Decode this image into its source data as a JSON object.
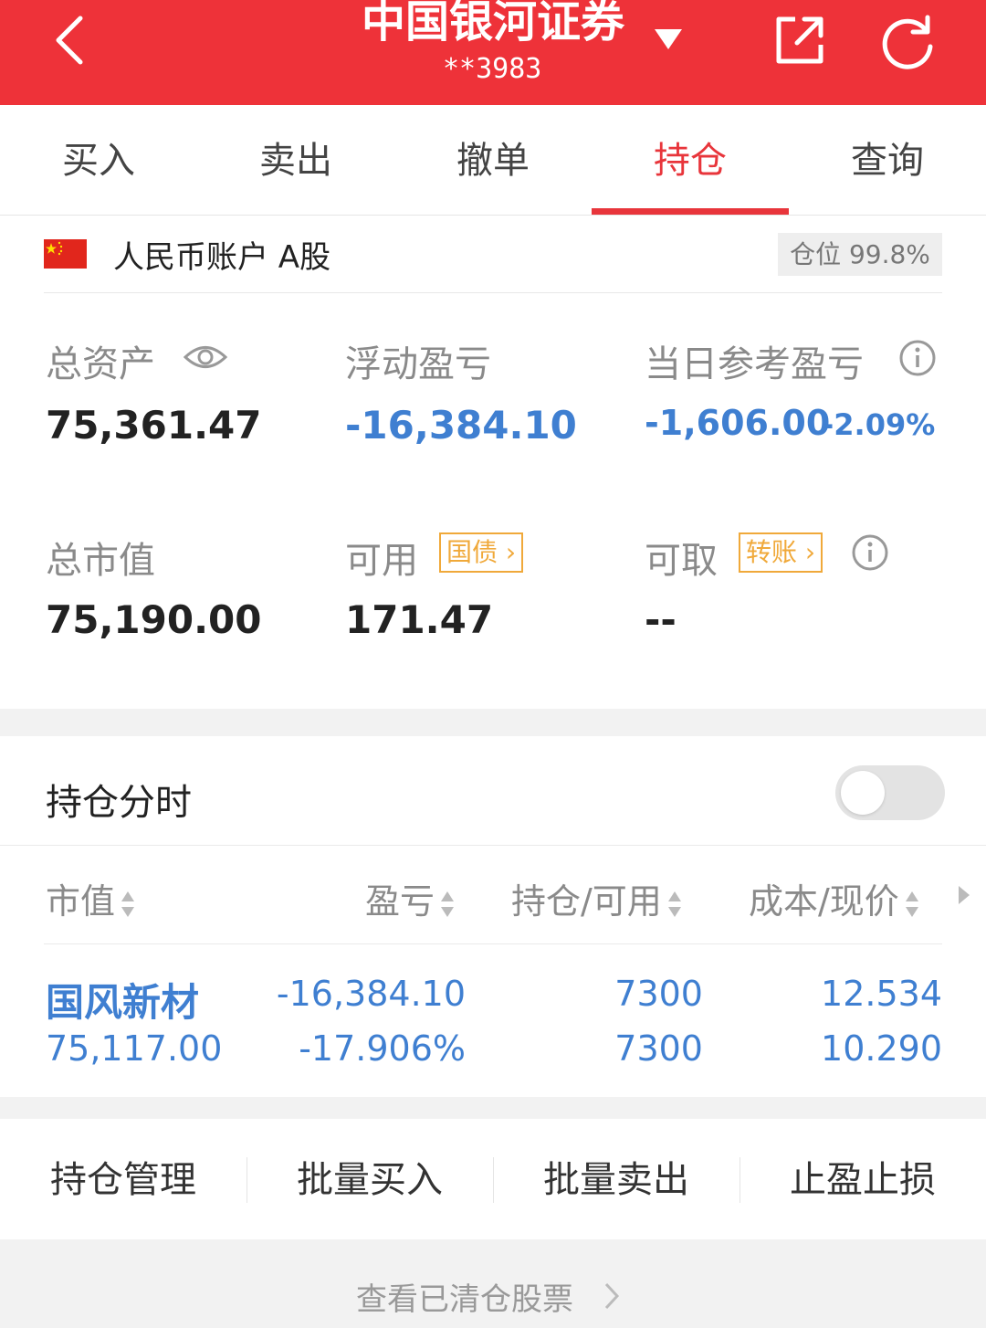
{
  "header": {
    "title": "中国银河证券",
    "account_masked": "**3983"
  },
  "tabs": [
    "买入",
    "卖出",
    "撤单",
    "持仓",
    "查询"
  ],
  "account": {
    "name": "人民币账户 A股",
    "position_label": "仓位 99.8%"
  },
  "summary": {
    "total_assets_label": "总资产",
    "total_assets": "75,361.47",
    "floating_pl_label": "浮动盈亏",
    "floating_pl": "-16,384.10",
    "daily_pl_label": "当日参考盈亏",
    "daily_pl": "-1,606.00",
    "daily_pl_pct": "-2.09%",
    "market_value_label": "总市值",
    "market_value": "75,190.00",
    "available_label": "可用",
    "available_tag": "国债",
    "available": "171.47",
    "withdrawable_label": "可取",
    "withdrawable_tag": "转账",
    "withdrawable": "--"
  },
  "intraday": {
    "label": "持仓分时",
    "enabled": false
  },
  "holdings": {
    "columns": [
      "市值",
      "盈亏",
      "持仓/可用",
      "成本/现价"
    ],
    "rows": [
      {
        "name": "国风新材",
        "market_value": "75,117.00",
        "pl": "-16,384.10",
        "pl_pct": "-17.906%",
        "position": "7300",
        "available": "7300",
        "cost": "12.534",
        "price": "10.290"
      }
    ]
  },
  "actions": [
    "持仓管理",
    "批量买入",
    "批量卖出",
    "止盈止损"
  ],
  "footer": {
    "cleared_link": "查看已清仓股票"
  },
  "colors": {
    "brand_red": "#ee3239",
    "loss_blue": "#3f7fd1",
    "tag_orange": "#f0a93a"
  }
}
